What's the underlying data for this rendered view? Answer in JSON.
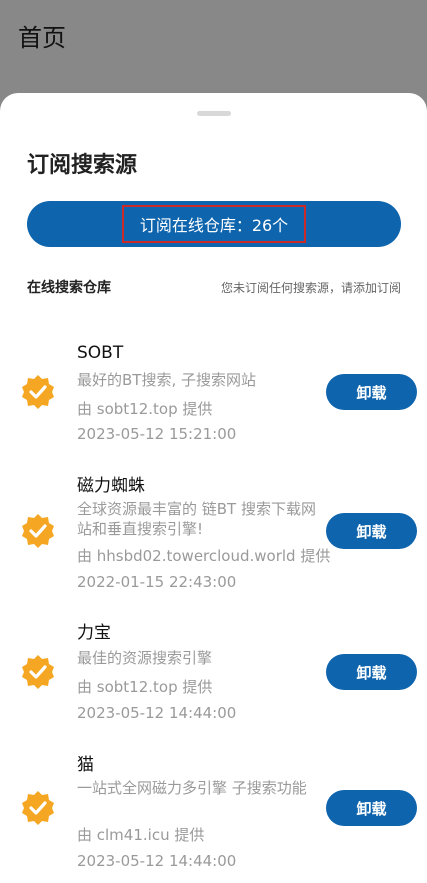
{
  "page": {
    "title": "首页"
  },
  "sheet": {
    "title": "订阅搜索源",
    "subscribe_button": "订阅在线仓库：26个",
    "section_title": "在线搜索仓库",
    "section_note": "您未订阅任何搜索源，请添加订阅"
  },
  "colors": {
    "accent": "#0e64ad",
    "badge": "#f5a623",
    "highlight_border": "#cc2a2a"
  },
  "items": [
    {
      "name": "SOBT",
      "desc": "最好的BT搜索,  子搜索网站",
      "provider": "由 sobt12.top 提供",
      "time": "2023-05-12 15:21:00",
      "action": "卸载"
    },
    {
      "name": "磁力蜘蛛",
      "desc": "全球资源最丰富的    链BT      搜索下载网站和垂直搜索引擎!",
      "provider": "由 hhsbd02.towercloud.world 提供",
      "time": "2022-01-15 22:43:00",
      "action": "卸载"
    },
    {
      "name": "力宝",
      "desc": "最佳的资源搜索引擎",
      "provider": "由 sobt12.top 提供",
      "time": "2023-05-12 14:44:00",
      "action": "卸载"
    },
    {
      "name": "猫",
      "desc": "一站式全网磁力多引擎          子搜索功能",
      "provider": "由 clm41.icu 提供",
      "time": "2023-05-12 14:44:00",
      "action": "卸载"
    }
  ]
}
